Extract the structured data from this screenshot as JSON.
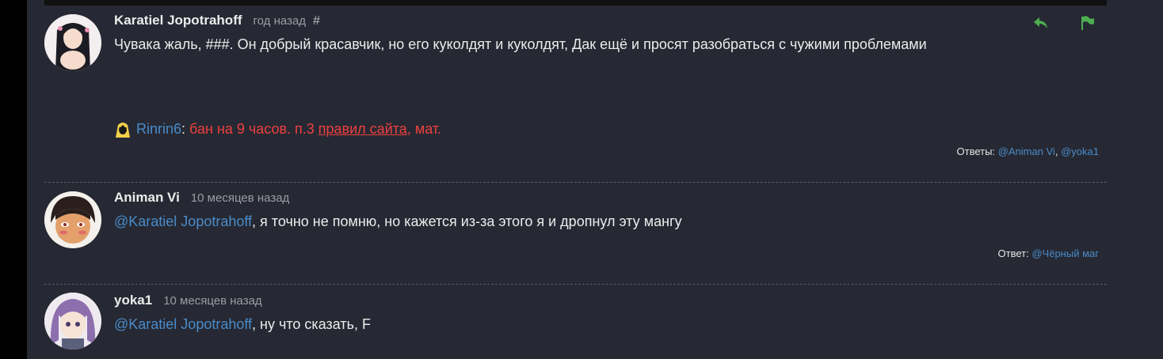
{
  "comments": [
    {
      "author": "Karatiel Jopotrahoff",
      "time": "год назад",
      "hash": "#",
      "text": "Чувака жаль, ###. Он добрый красавчик, но его куколдят и куколдят, Дак ещё и просят разобраться с чужими проблемами",
      "ban": {
        "moderator": "Rinrin6",
        "sep": ":",
        "prefix": " бан на 9 часов. п.3 ",
        "rules_link": "правил сайта",
        "suffix": ", мат."
      },
      "answers_label": "Ответы: ",
      "answers": [
        "@Animan Vi",
        "@yoka1"
      ],
      "answers_sep": ", "
    },
    {
      "author": "Animan Vi",
      "time": "10 месяцев назад",
      "mention": "@Karatiel Jopotrahoff",
      "text": ", я точно не помню, но кажется из-за этого я и дропнул эту мангу",
      "answers_label": "Ответ: ",
      "answers": [
        "@Чёрный маг"
      ]
    },
    {
      "author": "yoka1",
      "time": "10 месяцев назад",
      "mention": "@Karatiel Jopotrahoff",
      "text": ", ну что сказать, F"
    }
  ],
  "icons": {
    "reply": "reply-arrow-icon",
    "report": "flag-icon",
    "accent": "#4caf50"
  }
}
